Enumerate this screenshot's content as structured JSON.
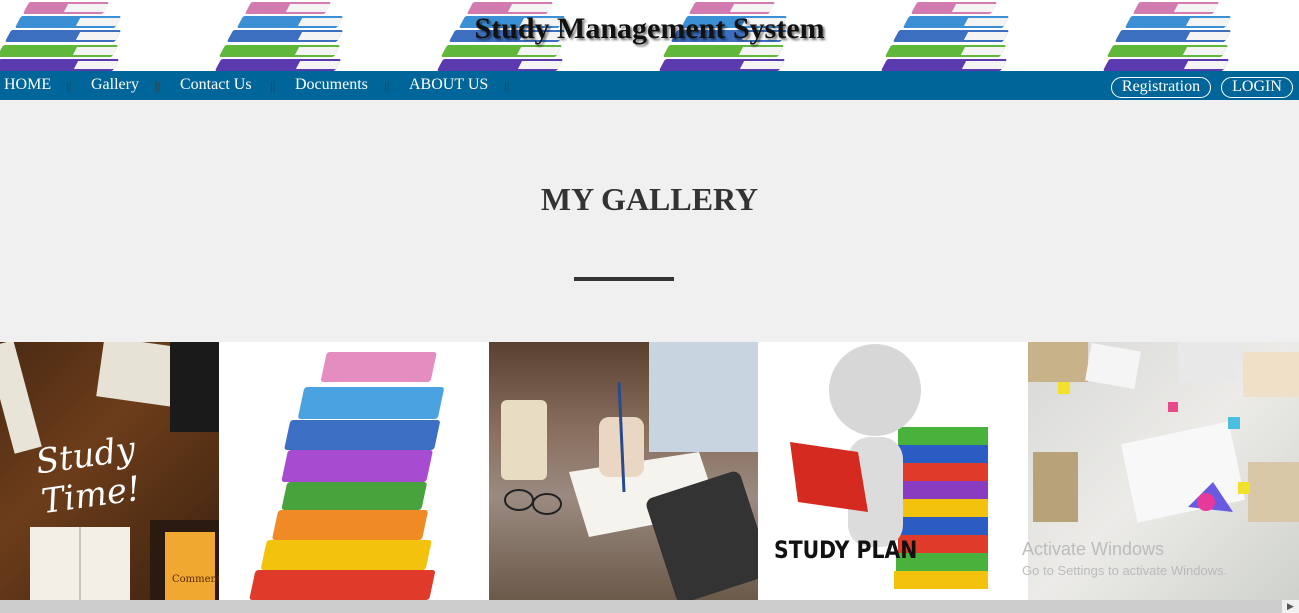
{
  "header": {
    "title": "Study Management System"
  },
  "nav": {
    "items": [
      "HOME",
      "Gallery",
      "Contact Us",
      "Documents",
      "ABOUT US"
    ],
    "separator": "||",
    "registration_label": "Registration",
    "login_label": "LOGIN"
  },
  "main": {
    "heading": "MY GALLERY"
  },
  "gallery": {
    "study_time_caption": "Study Time!",
    "study_plan_caption": "STUDY PLAN",
    "book_label": "Commentary on"
  },
  "watermark": {
    "line1": "Activate Windows",
    "line2": "Go to Settings to activate Windows."
  },
  "colors": {
    "navbar": "#006699",
    "background": "#f0f0f0",
    "heading": "#333333"
  },
  "icons": {
    "scroll_right": "arrow-right-icon"
  }
}
